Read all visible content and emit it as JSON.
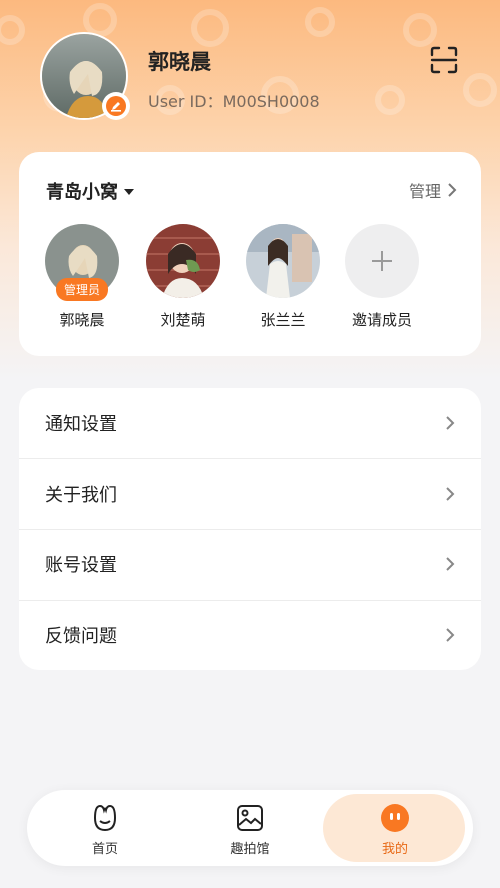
{
  "profile": {
    "name": "郭晓晨",
    "user_id": "User ID：M00SH0008"
  },
  "family": {
    "title": "青岛小窝",
    "manage_label": "管理",
    "members": [
      {
        "name": "郭晓晨",
        "badge": "管理员"
      },
      {
        "name": "刘楚萌"
      },
      {
        "name": "张兰兰"
      }
    ],
    "invite_label": "邀请成员"
  },
  "menu": [
    {
      "label": "通知设置"
    },
    {
      "label": "关于我们"
    },
    {
      "label": "账号设置"
    },
    {
      "label": "反馈问题"
    }
  ],
  "tabs": [
    {
      "label": "首页",
      "icon": "smile-face-icon"
    },
    {
      "label": "趣拍馆",
      "icon": "picture-icon"
    },
    {
      "label": "我的",
      "icon": "profile-face-icon",
      "active": true
    }
  ],
  "colors": {
    "accent": "#f97822",
    "active_tab_bg": "#fde8d5",
    "header_gradient_top": "#fcb97f"
  }
}
